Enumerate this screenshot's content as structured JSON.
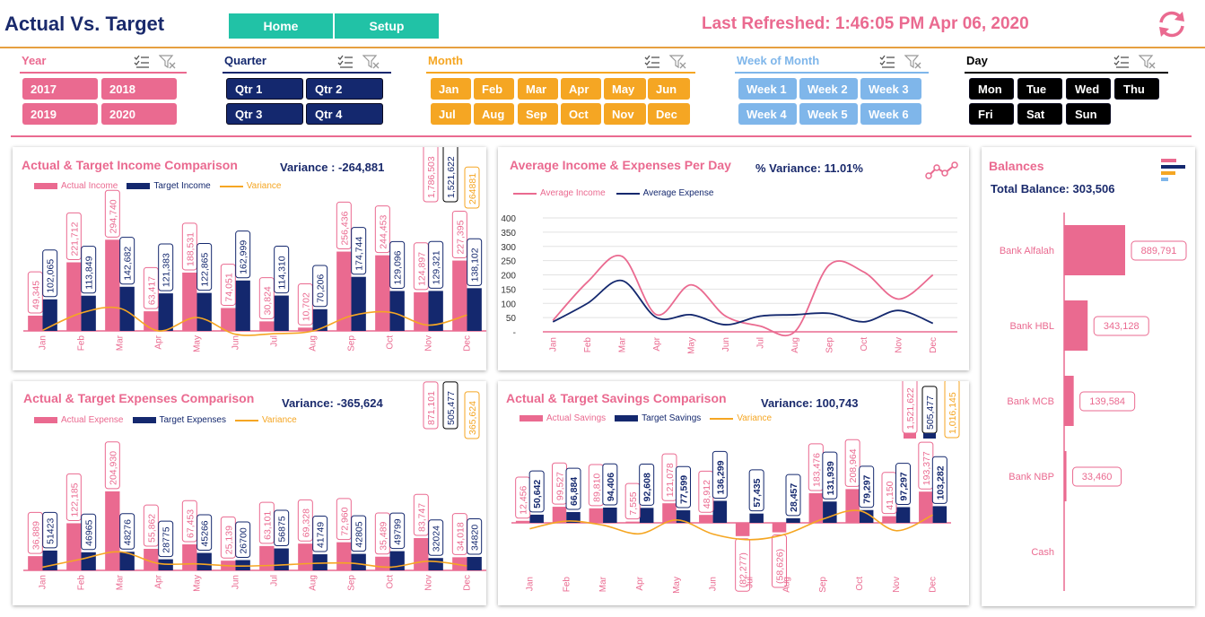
{
  "header": {
    "title": "Actual Vs. Target",
    "nav": [
      "Home",
      "Setup"
    ],
    "last_refreshed": "Last Refreshed: 1:46:05 PM Apr 06, 2020"
  },
  "colors": {
    "pink": "#ea6a90",
    "navy": "#14286e",
    "orange": "#f5a623",
    "light_blue": "#7fb6ea",
    "black": "#000000",
    "teal": "#21c2a6"
  },
  "slicers": {
    "year": {
      "label": "Year",
      "items": [
        "2017",
        "2018",
        "2019",
        "2020"
      ]
    },
    "quarter": {
      "label": "Quarter",
      "items": [
        "Qtr 1",
        "Qtr 2",
        "Qtr 3",
        "Qtr 4"
      ]
    },
    "month": {
      "label": "Month",
      "items": [
        "Jan",
        "Feb",
        "Mar",
        "Apr",
        "May",
        "Jun",
        "Jul",
        "Aug",
        "Sep",
        "Oct",
        "Nov",
        "Dec"
      ]
    },
    "week": {
      "label": "Week of Month",
      "items": [
        "Week 1",
        "Week 2",
        "Week 3",
        "Week 4",
        "Week 5",
        "Week 6"
      ]
    },
    "day": {
      "label": "Day",
      "items": [
        "Mon",
        "Tue",
        "Wed",
        "Thu",
        "Fri",
        "Sat",
        "Sun"
      ]
    }
  },
  "income": {
    "title": "Actual & Target Income Comparison",
    "variance": "Variance : -264,881",
    "legend": [
      "Actual Income",
      "Target Income",
      "Variance"
    ],
    "totals": [
      "1,786,503",
      "1,521,622",
      "264881"
    ]
  },
  "avg": {
    "title": "Average Income & Expenses Per Day",
    "variance": "% Variance: 11.01%",
    "legend": [
      "Average Income",
      "Average Expense"
    ]
  },
  "balances": {
    "title": "Balances",
    "total": "Total Balance: 303,506"
  },
  "expenses": {
    "title": "Actual & Target Expenses Comparison",
    "variance": "Variance: -365,624",
    "legend": [
      "Actual Expense",
      "Target Expenses",
      "Variance"
    ],
    "totals": [
      "871,101",
      "505,477",
      "365,624"
    ]
  },
  "savings": {
    "title": "Actual & Target Savings Comparison",
    "variance": "Variance: 100,743",
    "legend": [
      "Actual Savings",
      "Target Savings",
      "Variance"
    ],
    "totals": [
      "1,521,622",
      "505,477",
      "1,016,145"
    ]
  },
  "chart_data": [
    {
      "id": "income",
      "type": "bar",
      "categories": [
        "Jan",
        "Feb",
        "Mar",
        "Apr",
        "May",
        "Jun",
        "Jul",
        "Aug",
        "Sep",
        "Oct",
        "Nov",
        "Dec"
      ],
      "series": [
        {
          "name": "Actual Income",
          "values": [
            49345,
            221712,
            294740,
            63417,
            188531,
            74051,
            30824,
            10702,
            256436,
            244453,
            124897,
            227395
          ],
          "labels": [
            "49,345",
            "221,712",
            "294,740",
            "63,417",
            "188,531",
            "74,051",
            "30,824",
            "10,702",
            "256,436",
            "244,453",
            "124,897",
            "227,395"
          ]
        },
        {
          "name": "Target Income",
          "values": [
            102065,
            113849,
            142682,
            121383,
            122865,
            162999,
            114310,
            70206,
            174744,
            129096,
            129321,
            138102
          ],
          "labels": [
            "102,065",
            "113,849",
            "142,682",
            "121,383",
            "122,865",
            "162,999",
            "114,310",
            "70,206",
            "174,744",
            "129,096",
            "129,321",
            "138,102"
          ]
        },
        {
          "name": "Variance",
          "type": "line",
          "values": [
            -52720,
            107863,
            152058,
            -57966,
            65666,
            -88948,
            -83486,
            -59504,
            81692,
            115357,
            -4424,
            89293
          ]
        }
      ]
    },
    {
      "id": "avg",
      "type": "line",
      "categories": [
        "Jan",
        "Feb",
        "Mar",
        "Apr",
        "May",
        "Jun",
        "Jul",
        "Aug",
        "Sep",
        "Oct",
        "Nov",
        "Dec"
      ],
      "ylim": [
        0,
        400
      ],
      "yticks": [
        "400",
        "350",
        "300",
        "250",
        "200",
        "150",
        "100",
        "50",
        "-"
      ],
      "series": [
        {
          "name": "Average Income",
          "values": [
            40,
            175,
            265,
            60,
            165,
            55,
            20,
            0,
            235,
            210,
            115,
            200
          ]
        },
        {
          "name": "Average Expense",
          "values": [
            35,
            100,
            180,
            50,
            60,
            25,
            55,
            60,
            65,
            35,
            75,
            30
          ]
        }
      ]
    },
    {
      "id": "balances",
      "type": "bar",
      "orientation": "horizontal",
      "categories": [
        "Bank Alfalah",
        "Bank HBL",
        "Bank MCB",
        "Bank NBP",
        "Cash"
      ],
      "values": [
        889791,
        343128,
        139584,
        33460,
        0
      ],
      "labels": [
        "889,791",
        "343,128",
        "139,584",
        "33,460",
        ""
      ]
    },
    {
      "id": "expenses",
      "type": "bar",
      "categories": [
        "Jan",
        "Feb",
        "Mar",
        "Apr",
        "May",
        "Jun",
        "Jul",
        "Aug",
        "Sep",
        "Oct",
        "Nov",
        "Dec"
      ],
      "series": [
        {
          "name": "Actual Expense",
          "values": [
            36889,
            122185,
            204930,
            55862,
            67453,
            25139,
            63101,
            69328,
            72960,
            35489,
            83747,
            34018
          ],
          "labels": [
            "36,889",
            "122,185",
            "204,930",
            "55,862",
            "67,453",
            "25,139",
            "63,101",
            "69,328",
            "72,960",
            "35,489",
            "83,747",
            "34,018"
          ]
        },
        {
          "name": "Target Expenses",
          "values": [
            51423,
            46965,
            48276,
            28775,
            45266,
            26700,
            56875,
            41749,
            42805,
            49799,
            32024,
            34820
          ],
          "labels": [
            "51423",
            "46965",
            "48276",
            "28775",
            "45266",
            "26700",
            "56875",
            "41749",
            "42805",
            "49799",
            "32024",
            "34820"
          ]
        },
        {
          "name": "Variance",
          "type": "line",
          "values": [
            -14534,
            75220,
            156654,
            27087,
            22187,
            -1561,
            6226,
            27579,
            30155,
            -14310,
            51723,
            -802
          ]
        }
      ]
    },
    {
      "id": "savings",
      "type": "bar",
      "categories": [
        "Jan",
        "Feb",
        "Mar",
        "Apr",
        "May",
        "Jun",
        "Jul",
        "Aug",
        "Sep",
        "Oct",
        "Nov",
        "Dec"
      ],
      "series": [
        {
          "name": "Actual Savings",
          "values": [
            12456,
            99527,
            89810,
            7555,
            121078,
            48912,
            -82277,
            -58626,
            183476,
            208964,
            41150,
            193377
          ],
          "labels": [
            "12,456",
            "99,527",
            "89,810",
            "7,555",
            "121,078",
            "48,912",
            "(82,277)",
            "(58,626)",
            "183,476",
            "208,964",
            "41,150",
            "193,377"
          ]
        },
        {
          "name": "Target Savings",
          "values": [
            50642,
            66884,
            94406,
            92608,
            77599,
            136299,
            57435,
            28457,
            131939,
            79297,
            97297,
            103282
          ],
          "labels": [
            "50,642",
            "66,884",
            "94,406",
            "92,608",
            "77,599",
            "136,299",
            "57,435",
            "28,457",
            "131,939",
            "79,297",
            "97,297",
            "103,282"
          ]
        },
        {
          "name": "Variance",
          "type": "line",
          "values": [
            -38186,
            32643,
            -4596,
            -85053,
            43479,
            -87387,
            -139712,
            -87083,
            51537,
            129667,
            -56147,
            90095
          ]
        }
      ]
    }
  ]
}
